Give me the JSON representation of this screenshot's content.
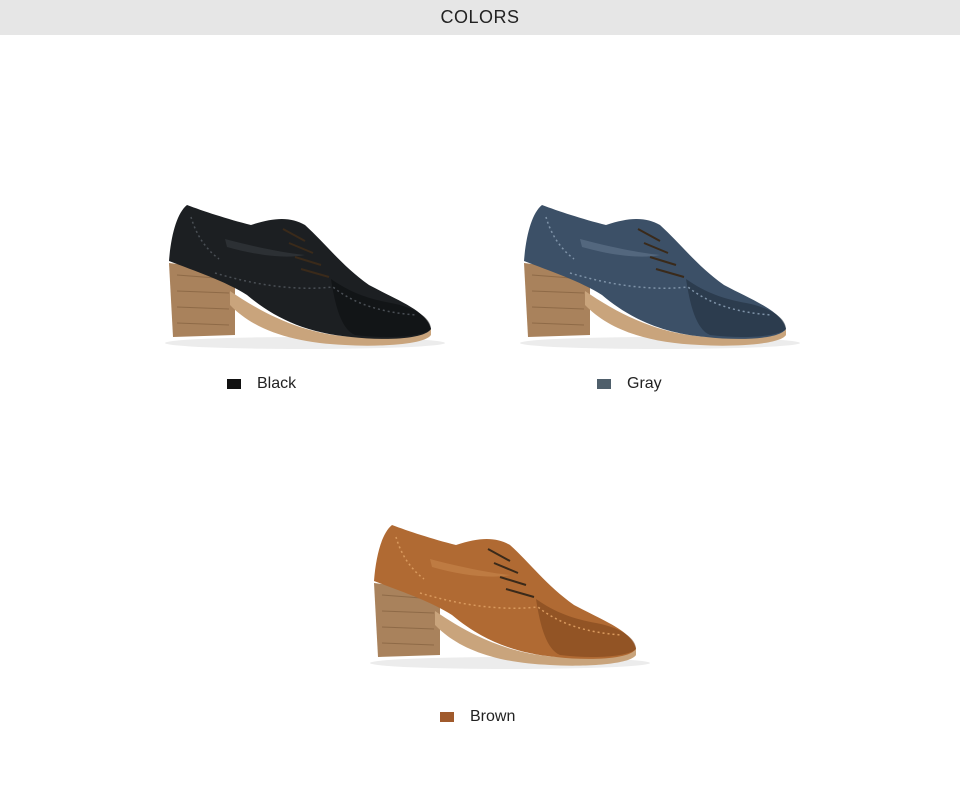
{
  "header": {
    "title": "COLORS"
  },
  "colors": [
    {
      "label": "Black",
      "swatch": "#111111",
      "upper": "#1c1f22",
      "upper_dark": "#0b0c0e",
      "highlight": "#4a4f55"
    },
    {
      "label": "Gray",
      "swatch": "#4f5f6b",
      "upper": "#3c5067",
      "upper_dark": "#1f2c3b",
      "highlight": "#7f93a8"
    },
    {
      "label": "Brown",
      "swatch": "#a05a2c",
      "upper": "#b06a33",
      "upper_dark": "#7a4219",
      "highlight": "#d99a5e"
    }
  ],
  "heel_color": "#a9825c",
  "sole_color": "#c9a47c"
}
